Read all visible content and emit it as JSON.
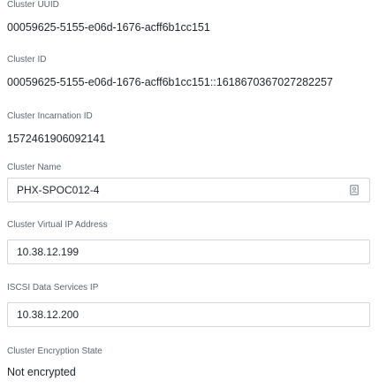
{
  "cluster_uuid": {
    "label": "Cluster UUID",
    "value": "00059625-5155-e06d-1676-acff6b1cc151"
  },
  "cluster_id": {
    "label": "Cluster ID",
    "value": "00059625-5155-e06d-1676-acff6b1cc151::1618670367027282257"
  },
  "cluster_incarnation_id": {
    "label": "Cluster Incarnation ID",
    "value": "1572461906092141"
  },
  "cluster_name": {
    "label": "Cluster Name",
    "value": "PHX-SPOC012-4",
    "icon": "contact-card-icon"
  },
  "cluster_virtual_ip": {
    "label": "Cluster Virtual IP Address",
    "value": "10.38.12.199"
  },
  "iscsi_data_services_ip": {
    "label": "ISCSI Data Services IP",
    "value": "10.38.12.200"
  },
  "cluster_encryption_state": {
    "label": "Cluster Encryption State",
    "value": "Not encrypted"
  }
}
